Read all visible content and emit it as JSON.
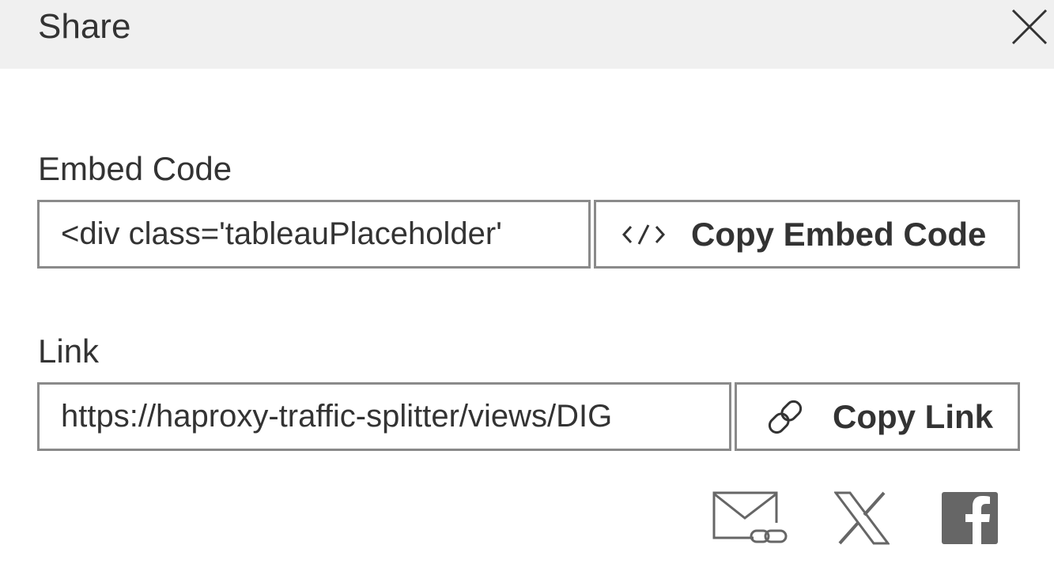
{
  "dialog": {
    "title": "Share",
    "close_icon": "close-x-icon"
  },
  "embed": {
    "label": "Embed Code",
    "value": "<div class='tableauPlaceholder'",
    "button_label": "Copy Embed Code",
    "button_icon": "code-brackets-icon"
  },
  "link": {
    "label": "Link",
    "value": "https://haproxy-traffic-splitter/views/DIG",
    "button_label": "Copy Link",
    "button_icon": "chain-link-icon"
  },
  "social": [
    {
      "name": "email",
      "icon": "email-link-icon"
    },
    {
      "name": "x",
      "icon": "x-logo-icon"
    },
    {
      "name": "facebook",
      "icon": "facebook-logo-icon"
    }
  ],
  "colors": {
    "header_bg": "#f0f0f0",
    "text": "#333333",
    "border": "#8a8a8a",
    "icon": "#666666"
  }
}
